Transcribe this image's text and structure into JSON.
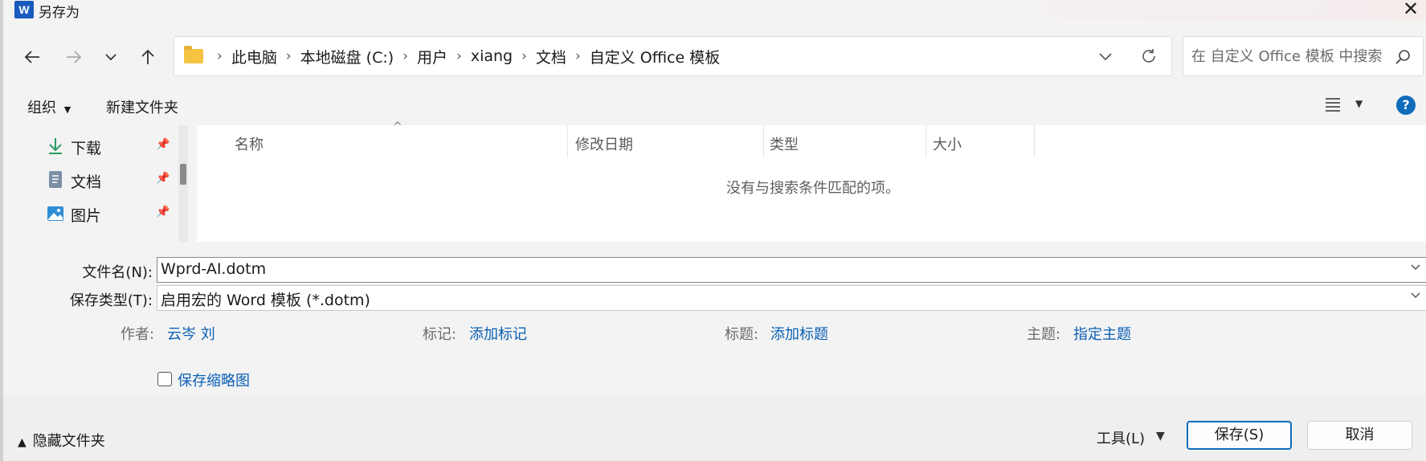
{
  "window": {
    "title": "另存为",
    "app_icon": "word-icon",
    "app_icon_letter": "W",
    "close_glyph": "✕"
  },
  "nav": {
    "back_icon": "arrow-left-icon",
    "forward_icon": "arrow-right-icon",
    "recent_icon": "chevron-down-icon",
    "up_icon": "arrow-up-icon"
  },
  "address": {
    "crumbs": [
      "此电脑",
      "本地磁盘 (C:)",
      "用户",
      "xiang",
      "文档",
      "自定义 Office 模板"
    ]
  },
  "search": {
    "placeholder": "在 自定义 Office 模板 中搜索"
  },
  "toolbar": {
    "organize_label": "组织",
    "new_folder_label": "新建文件夹",
    "help_label": "?"
  },
  "sidebar": {
    "items": [
      {
        "label": "下载",
        "icon": "download-icon",
        "pinned": true
      },
      {
        "label": "文档",
        "icon": "document-icon",
        "pinned": true
      },
      {
        "label": "图片",
        "icon": "pictures-icon",
        "pinned": true
      }
    ]
  },
  "filelist": {
    "columns": [
      "名称",
      "修改日期",
      "类型",
      "大小"
    ],
    "empty_message": "没有与搜索条件匹配的项。"
  },
  "form": {
    "filename_label": "文件名(N):",
    "filename_value": "Wprd-AI.dotm",
    "filetype_label": "保存类型(T):",
    "filetype_value": "启用宏的 Word 模板 (*.dotm)",
    "author_label": "作者:",
    "author_value": "云岑 刘",
    "tags_label": "标记:",
    "tags_value": "添加标记",
    "title_label": "标题:",
    "title_value": "添加标题",
    "subject_label": "主题:",
    "subject_value": "指定主题",
    "thumbnail_label": "保存缩略图",
    "thumbnail_checked": false
  },
  "footer": {
    "hide_folders_label": "隐藏文件夹",
    "tools_label": "工具(L)",
    "save_label": "保存(S)",
    "cancel_label": "取消"
  },
  "colors": {
    "accent": "#0f6cbd",
    "link": "#0a5fb4",
    "folder": "#f5c442"
  }
}
